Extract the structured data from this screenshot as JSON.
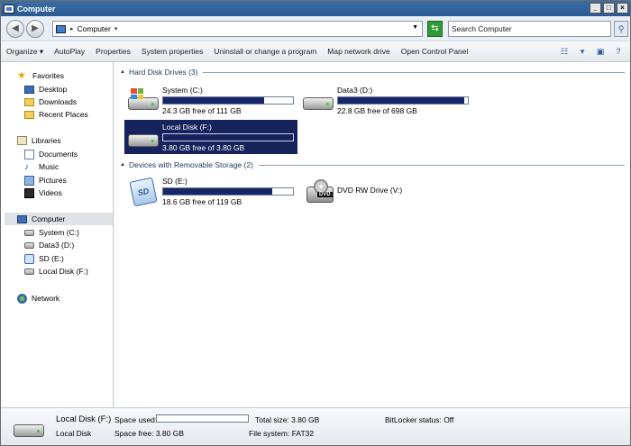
{
  "window": {
    "title": "Computer",
    "controls": [
      "_",
      "□",
      "×"
    ]
  },
  "address": {
    "location": "Computer",
    "search_placeholder": "Search Computer"
  },
  "toolbar": {
    "items": [
      "Organize ▾",
      "AutoPlay",
      "Properties",
      "System properties",
      "Uninstall or change a program",
      "Map network drive",
      "Open Control Panel"
    ]
  },
  "sidebar": {
    "favorites": {
      "label": "Favorites",
      "items": [
        "Desktop",
        "Downloads",
        "Recent Places"
      ]
    },
    "libraries": {
      "label": "Libraries",
      "items": [
        "Documents",
        "Music",
        "Pictures",
        "Videos"
      ]
    },
    "computer": {
      "label": "Computer",
      "items": [
        "System (C:)",
        "Data3 (D:)",
        "SD (E:)",
        "Local Disk (F:)"
      ]
    },
    "network": {
      "label": "Network"
    }
  },
  "groups": {
    "hard_disk": "Hard Disk Drives (3)",
    "removable": "Devices with Removable Storage (2)"
  },
  "drives": {
    "c": {
      "name": "System (C:)",
      "free": "24.3 GB free of 111 GB",
      "used_fraction": 0.78
    },
    "d": {
      "name": "Data3 (D:)",
      "free": "22.8 GB free of 698 GB",
      "used_fraction": 0.97
    },
    "f": {
      "name": "Local Disk (F:)",
      "free": "3.80 GB free of 3.80 GB",
      "used_fraction": 0.0
    },
    "e": {
      "name": "SD (E:)",
      "free": "18.6 GB free of 119 GB",
      "used_fraction": 0.84
    },
    "v": {
      "name": "DVD RW Drive (V:)"
    }
  },
  "details": {
    "title": "Local Disk (F:)",
    "subtitle": "Local Disk",
    "space_used_label": "Space used:",
    "space_used_fraction": 0.0,
    "space_free": "Space free:  3.80 GB",
    "total_size": "Total size:  3.80 GB",
    "file_system": "File system:  FAT32",
    "bitlocker": "BitLocker status:  Off"
  }
}
